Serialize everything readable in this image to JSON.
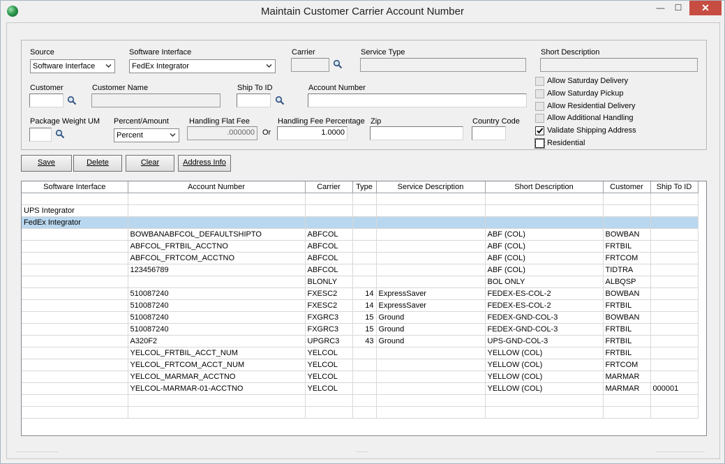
{
  "window": {
    "title": "Maintain Customer Carrier Account Number",
    "minimize_glyph": "—",
    "maximize_glyph": "☐",
    "close_glyph": "✕",
    "app_icon": "globe-icon"
  },
  "form": {
    "source": {
      "label": "Source",
      "value": "Software Interface"
    },
    "software_interface": {
      "label": "Software Interface",
      "value": "FedEx Integrator"
    },
    "carrier": {
      "label": "Carrier",
      "value": ""
    },
    "service_type": {
      "label": "Service Type",
      "value": ""
    },
    "short_description": {
      "label": "Short Description",
      "value": ""
    },
    "customer": {
      "label": "Customer",
      "value": ""
    },
    "customer_name": {
      "label": "Customer Name",
      "value": ""
    },
    "ship_to_id": {
      "label": "Ship To ID",
      "value": ""
    },
    "account_number": {
      "label": "Account Number",
      "value": ""
    },
    "package_weight_um": {
      "label": "Package Weight UM",
      "value": ""
    },
    "percent_amount": {
      "label": "Percent/Amount",
      "value": "Percent"
    },
    "handling_flat_fee": {
      "label": "Handling Flat Fee",
      "value": ".000000"
    },
    "or_label": "Or",
    "handling_fee_percentage": {
      "label": "Handling Fee Percentage",
      "value": "1.0000"
    },
    "zip": {
      "label": "Zip",
      "value": ""
    },
    "country_code": {
      "label": "Country Code",
      "value": ""
    }
  },
  "options": [
    {
      "label": "Allow Saturday Delivery",
      "checked": false,
      "enabled": false
    },
    {
      "label": "Allow Saturday Pickup",
      "checked": false,
      "enabled": false
    },
    {
      "label": "Allow Residential Delivery",
      "checked": false,
      "enabled": false
    },
    {
      "label": "Allow Additional Handling",
      "checked": false,
      "enabled": false
    },
    {
      "label": "Validate Shipping Address",
      "checked": true,
      "enabled": true
    },
    {
      "label": "Residential",
      "checked": false,
      "enabled": true
    }
  ],
  "buttons": {
    "save": "Save",
    "delete": "Delete",
    "clear": "Clear",
    "address_info": "Address Info"
  },
  "grid": {
    "columns": [
      "Software Interface",
      "Account Number",
      "Carrier",
      "Type",
      "Service Description",
      "Short Description",
      "Customer",
      "Ship To ID"
    ],
    "rows": [
      [
        "",
        "",
        "",
        "",
        "",
        "",
        "",
        ""
      ],
      [
        "UPS Integrator",
        "",
        "",
        "",
        "",
        "",
        "",
        ""
      ],
      [
        "FedEx Integrator",
        "",
        "",
        "",
        "",
        "",
        "",
        ""
      ],
      [
        "",
        "BOWBANABFCOL_DEFAULTSHIPTO",
        "ABFCOL",
        "",
        "",
        "ABF (COL)",
        "BOWBAN",
        ""
      ],
      [
        "",
        "ABFCOL_FRTBIL_ACCTNO",
        "ABFCOL",
        "",
        "",
        "ABF (COL)",
        "FRTBIL",
        ""
      ],
      [
        "",
        "ABFCOL_FRTCOM_ACCTNO",
        "ABFCOL",
        "",
        "",
        "ABF (COL)",
        "FRTCOM",
        ""
      ],
      [
        "",
        "123456789",
        "ABFCOL",
        "",
        "",
        "ABF (COL)",
        "TIDTRA",
        ""
      ],
      [
        "",
        "",
        "BLONLY",
        "",
        "",
        "BOL ONLY",
        "ALBQSP",
        ""
      ],
      [
        "",
        "510087240",
        "FXESC2",
        "14",
        "ExpressSaver",
        "FEDEX-ES-COL-2",
        "BOWBAN",
        ""
      ],
      [
        "",
        "510087240",
        "FXESC2",
        "14",
        "ExpressSaver",
        "FEDEX-ES-COL-2",
        "FRTBIL",
        ""
      ],
      [
        "",
        "510087240",
        "FXGRC3",
        "15",
        "Ground",
        "FEDEX-GND-COL-3",
        "BOWBAN",
        ""
      ],
      [
        "",
        "510087240",
        "FXGRC3",
        "15",
        "Ground",
        "FEDEX-GND-COL-3",
        "FRTBIL",
        ""
      ],
      [
        "",
        "A320F2",
        "UPGRC3",
        "43",
        "Ground",
        "UPS-GND-COL-3",
        "FRTBIL",
        ""
      ],
      [
        "",
        "YELCOL_FRTBIL_ACCT_NUM",
        "YELCOL",
        "",
        "",
        "YELLOW (COL)",
        "FRTBIL",
        ""
      ],
      [
        "",
        "YELCOL_FRTCOM_ACCT_NUM",
        "YELCOL",
        "",
        "",
        "YELLOW (COL)",
        "FRTCOM",
        ""
      ],
      [
        "",
        "YELCOL_MARMAR_ACCTNO",
        "YELCOL",
        "",
        "",
        "YELLOW (COL)",
        "MARMAR",
        ""
      ],
      [
        "",
        "YELCOL-MARMAR-01-ACCTNO",
        "YELCOL",
        "",
        "",
        "YELLOW (COL)",
        "MARMAR",
        "000001"
      ],
      [
        "",
        "",
        "",
        "",
        "",
        "",
        "",
        ""
      ],
      [
        "",
        "",
        "",
        "",
        "",
        "",
        "",
        ""
      ]
    ],
    "selected_row": 2
  },
  "colors": {
    "selection": "#b9d7ee",
    "close_button": "#c74d42"
  }
}
